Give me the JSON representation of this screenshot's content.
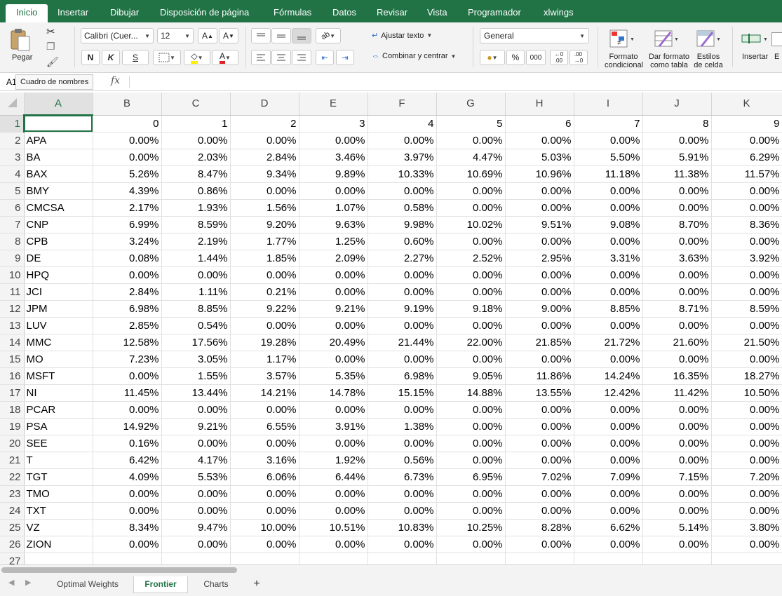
{
  "ribbon_tabs": [
    "Inicio",
    "Insertar",
    "Dibujar",
    "Disposición de página",
    "Fórmulas",
    "Datos",
    "Revisar",
    "Vista",
    "Programador",
    "xlwings"
  ],
  "ribbon": {
    "paste_label": "Pegar",
    "font_name": "Calibri (Cuer...",
    "font_size": "12",
    "bold": "N",
    "italic": "K",
    "underline": "S",
    "wrap_text": "Ajustar texto",
    "merge_center": "Combinar y centrar",
    "number_format": "General",
    "percent": "%",
    "thousands": "000",
    "cond_format_1": "Formato",
    "cond_format_2": "condicional",
    "table_format_1": "Dar formato",
    "table_format_2": "como tabla",
    "cell_styles_1": "Estilos",
    "cell_styles_2": "de celda",
    "insert_label": "Insertar",
    "delete_label_partial": "E"
  },
  "formula_bar": {
    "name_box": "A1",
    "tooltip": "Cuadro de nombres",
    "fx": "fx",
    "formula": ""
  },
  "columns": [
    "A",
    "B",
    "C",
    "D",
    "E",
    "F",
    "G",
    "H",
    "I",
    "J",
    "K"
  ],
  "header_row": [
    "",
    "0",
    "1",
    "2",
    "3",
    "4",
    "5",
    "6",
    "7",
    "8",
    "9"
  ],
  "rows": [
    [
      "APA",
      "0.00%",
      "0.00%",
      "0.00%",
      "0.00%",
      "0.00%",
      "0.00%",
      "0.00%",
      "0.00%",
      "0.00%",
      "0.00%"
    ],
    [
      "BA",
      "0.00%",
      "2.03%",
      "2.84%",
      "3.46%",
      "3.97%",
      "4.47%",
      "5.03%",
      "5.50%",
      "5.91%",
      "6.29%"
    ],
    [
      "BAX",
      "5.26%",
      "8.47%",
      "9.34%",
      "9.89%",
      "10.33%",
      "10.69%",
      "10.96%",
      "11.18%",
      "11.38%",
      "11.57%"
    ],
    [
      "BMY",
      "4.39%",
      "0.86%",
      "0.00%",
      "0.00%",
      "0.00%",
      "0.00%",
      "0.00%",
      "0.00%",
      "0.00%",
      "0.00%"
    ],
    [
      "CMCSA",
      "2.17%",
      "1.93%",
      "1.56%",
      "1.07%",
      "0.58%",
      "0.00%",
      "0.00%",
      "0.00%",
      "0.00%",
      "0.00%"
    ],
    [
      "CNP",
      "6.99%",
      "8.59%",
      "9.20%",
      "9.63%",
      "9.98%",
      "10.02%",
      "9.51%",
      "9.08%",
      "8.70%",
      "8.36%"
    ],
    [
      "CPB",
      "3.24%",
      "2.19%",
      "1.77%",
      "1.25%",
      "0.60%",
      "0.00%",
      "0.00%",
      "0.00%",
      "0.00%",
      "0.00%"
    ],
    [
      "DE",
      "0.08%",
      "1.44%",
      "1.85%",
      "2.09%",
      "2.27%",
      "2.52%",
      "2.95%",
      "3.31%",
      "3.63%",
      "3.92%"
    ],
    [
      "HPQ",
      "0.00%",
      "0.00%",
      "0.00%",
      "0.00%",
      "0.00%",
      "0.00%",
      "0.00%",
      "0.00%",
      "0.00%",
      "0.00%"
    ],
    [
      "JCI",
      "2.84%",
      "1.11%",
      "0.21%",
      "0.00%",
      "0.00%",
      "0.00%",
      "0.00%",
      "0.00%",
      "0.00%",
      "0.00%"
    ],
    [
      "JPM",
      "6.98%",
      "8.85%",
      "9.22%",
      "9.21%",
      "9.19%",
      "9.18%",
      "9.00%",
      "8.85%",
      "8.71%",
      "8.59%"
    ],
    [
      "LUV",
      "2.85%",
      "0.54%",
      "0.00%",
      "0.00%",
      "0.00%",
      "0.00%",
      "0.00%",
      "0.00%",
      "0.00%",
      "0.00%"
    ],
    [
      "MMC",
      "12.58%",
      "17.56%",
      "19.28%",
      "20.49%",
      "21.44%",
      "22.00%",
      "21.85%",
      "21.72%",
      "21.60%",
      "21.50%"
    ],
    [
      "MO",
      "7.23%",
      "3.05%",
      "1.17%",
      "0.00%",
      "0.00%",
      "0.00%",
      "0.00%",
      "0.00%",
      "0.00%",
      "0.00%"
    ],
    [
      "MSFT",
      "0.00%",
      "1.55%",
      "3.57%",
      "5.35%",
      "6.98%",
      "9.05%",
      "11.86%",
      "14.24%",
      "16.35%",
      "18.27%"
    ],
    [
      "NI",
      "11.45%",
      "13.44%",
      "14.21%",
      "14.78%",
      "15.15%",
      "14.88%",
      "13.55%",
      "12.42%",
      "11.42%",
      "10.50%"
    ],
    [
      "PCAR",
      "0.00%",
      "0.00%",
      "0.00%",
      "0.00%",
      "0.00%",
      "0.00%",
      "0.00%",
      "0.00%",
      "0.00%",
      "0.00%"
    ],
    [
      "PSA",
      "14.92%",
      "9.21%",
      "6.55%",
      "3.91%",
      "1.38%",
      "0.00%",
      "0.00%",
      "0.00%",
      "0.00%",
      "0.00%"
    ],
    [
      "SEE",
      "0.16%",
      "0.00%",
      "0.00%",
      "0.00%",
      "0.00%",
      "0.00%",
      "0.00%",
      "0.00%",
      "0.00%",
      "0.00%"
    ],
    [
      "T",
      "6.42%",
      "4.17%",
      "3.16%",
      "1.92%",
      "0.56%",
      "0.00%",
      "0.00%",
      "0.00%",
      "0.00%",
      "0.00%"
    ],
    [
      "TGT",
      "4.09%",
      "5.53%",
      "6.06%",
      "6.44%",
      "6.73%",
      "6.95%",
      "7.02%",
      "7.09%",
      "7.15%",
      "7.20%"
    ],
    [
      "TMO",
      "0.00%",
      "0.00%",
      "0.00%",
      "0.00%",
      "0.00%",
      "0.00%",
      "0.00%",
      "0.00%",
      "0.00%",
      "0.00%"
    ],
    [
      "TXT",
      "0.00%",
      "0.00%",
      "0.00%",
      "0.00%",
      "0.00%",
      "0.00%",
      "0.00%",
      "0.00%",
      "0.00%",
      "0.00%"
    ],
    [
      "VZ",
      "8.34%",
      "9.47%",
      "10.00%",
      "10.51%",
      "10.83%",
      "10.25%",
      "8.28%",
      "6.62%",
      "5.14%",
      "3.80%"
    ],
    [
      "ZION",
      "0.00%",
      "0.00%",
      "0.00%",
      "0.00%",
      "0.00%",
      "0.00%",
      "0.00%",
      "0.00%",
      "0.00%",
      "0.00%"
    ]
  ],
  "sheet_tabs": [
    "Optimal Weights",
    "Frontier",
    "Charts"
  ],
  "active_sheet": "Frontier",
  "add_sheet": "+",
  "colors": {
    "accent": "#217346",
    "ribbon_bg": "#f3f3f3",
    "font_red": "#e01f1f",
    "highlight_yellow": "#ffee00"
  }
}
